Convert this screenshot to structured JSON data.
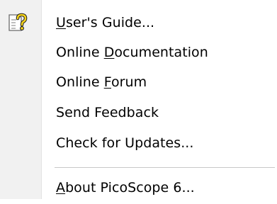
{
  "menu": {
    "items": [
      {
        "pre": "",
        "accel": "U",
        "post": "ser's Guide...",
        "icon": "help-document-icon"
      },
      {
        "pre": "Online ",
        "accel": "D",
        "post": "ocumentation"
      },
      {
        "pre": "Online ",
        "accel": "F",
        "post": "orum"
      },
      {
        "pre": "Send Feedback",
        "accel": "",
        "post": ""
      },
      {
        "pre": "Check for Updates...",
        "accel": "",
        "post": ""
      },
      {
        "pre": "",
        "accel": "A",
        "post": "bout PicoScope 6..."
      }
    ]
  }
}
